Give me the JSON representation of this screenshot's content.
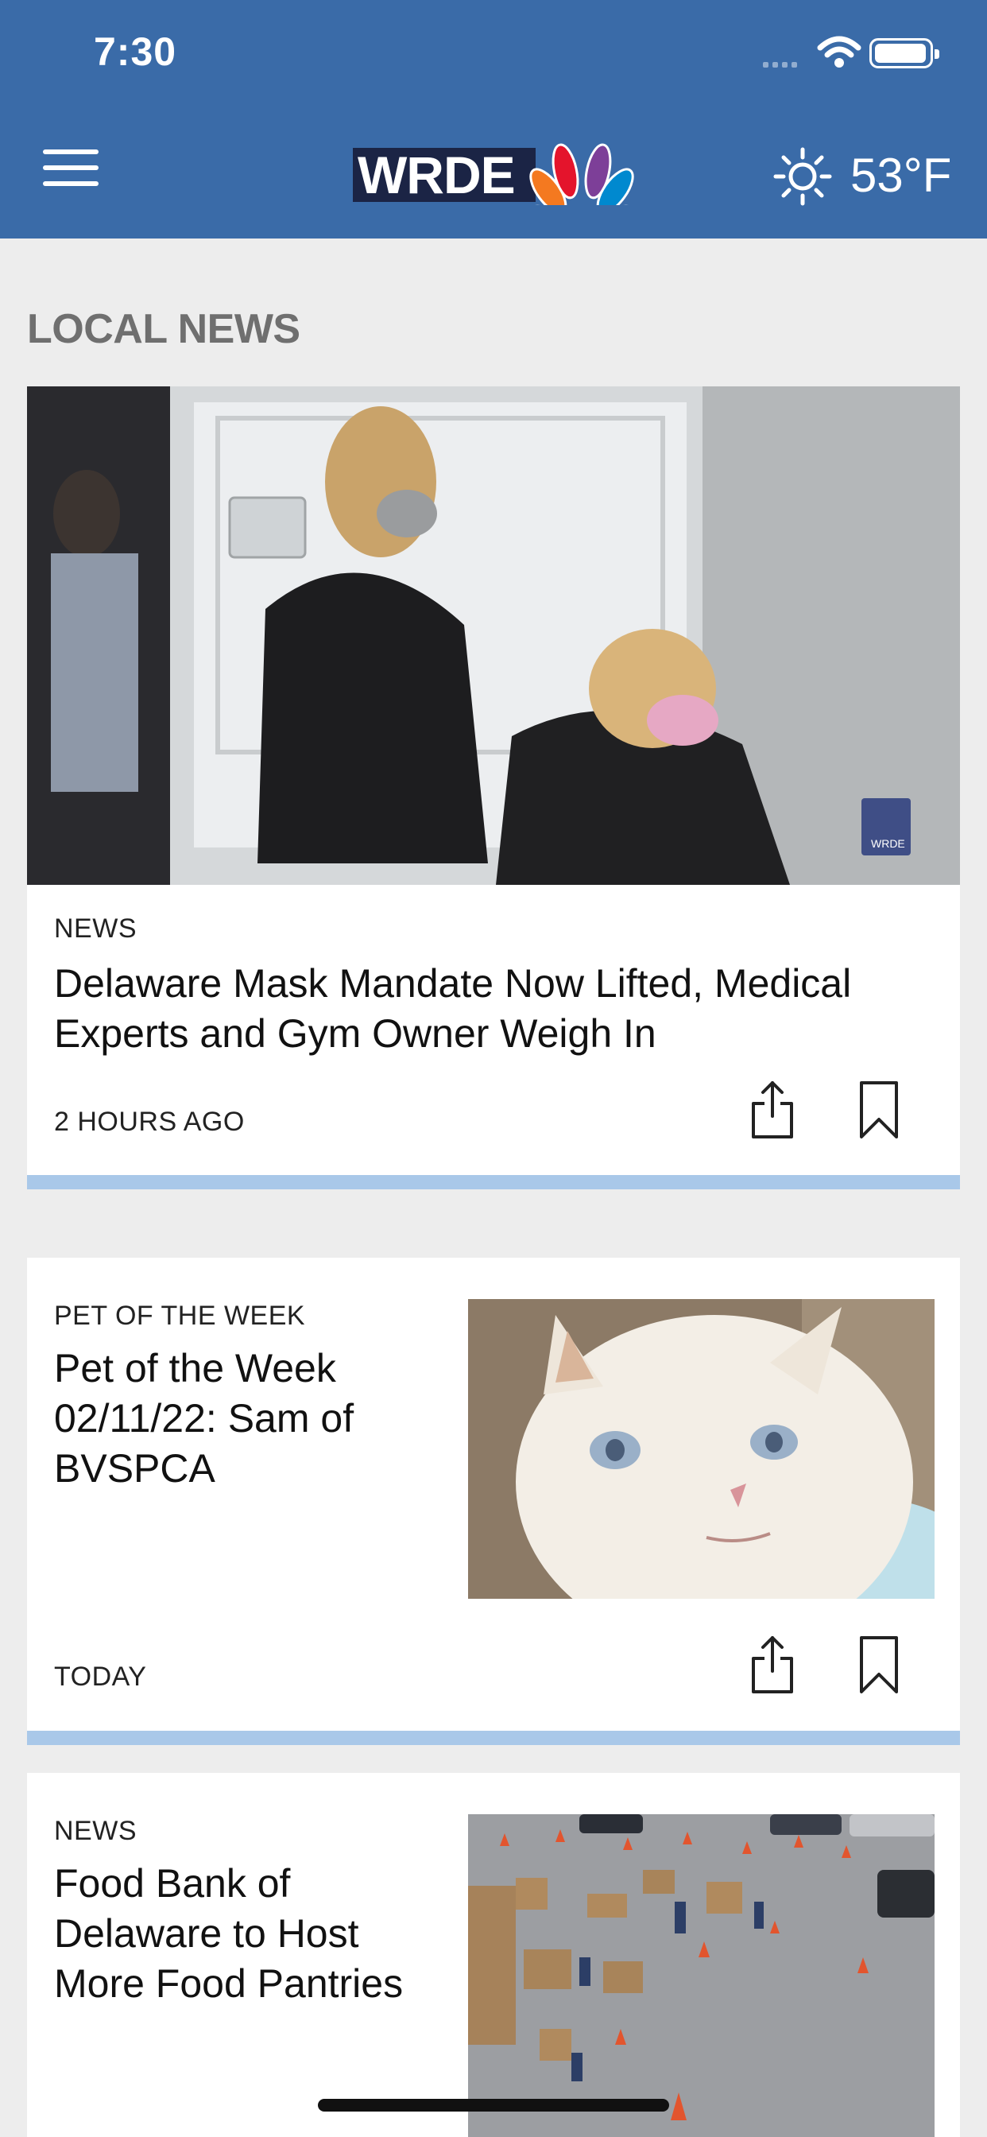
{
  "status_bar": {
    "time": "7:30"
  },
  "header": {
    "logo_text": "WRDE",
    "weather_temp": "53°F",
    "weather_icon": "sun-icon"
  },
  "section": {
    "title": "LOCAL NEWS"
  },
  "articles": [
    {
      "category": "NEWS",
      "headline_lines": [
        "Delaware Mask Mandate Now Lifted, Medical",
        "Experts and Gym Owner Weigh In"
      ],
      "timestamp": "2 HOURS AGO"
    },
    {
      "category": "PET OF THE WEEK",
      "headline_lines": [
        "Pet of the Week",
        "02/11/22: Sam of",
        "BVSPCA"
      ],
      "timestamp": "TODAY"
    },
    {
      "category": "NEWS",
      "headline_lines": [
        "Food Bank of",
        "Delaware to Host",
        "More Food Pantries"
      ],
      "timestamp": ""
    }
  ],
  "colors": {
    "header": "#3a6ba8",
    "divider": "#a9c8e9",
    "background": "#ededed"
  }
}
